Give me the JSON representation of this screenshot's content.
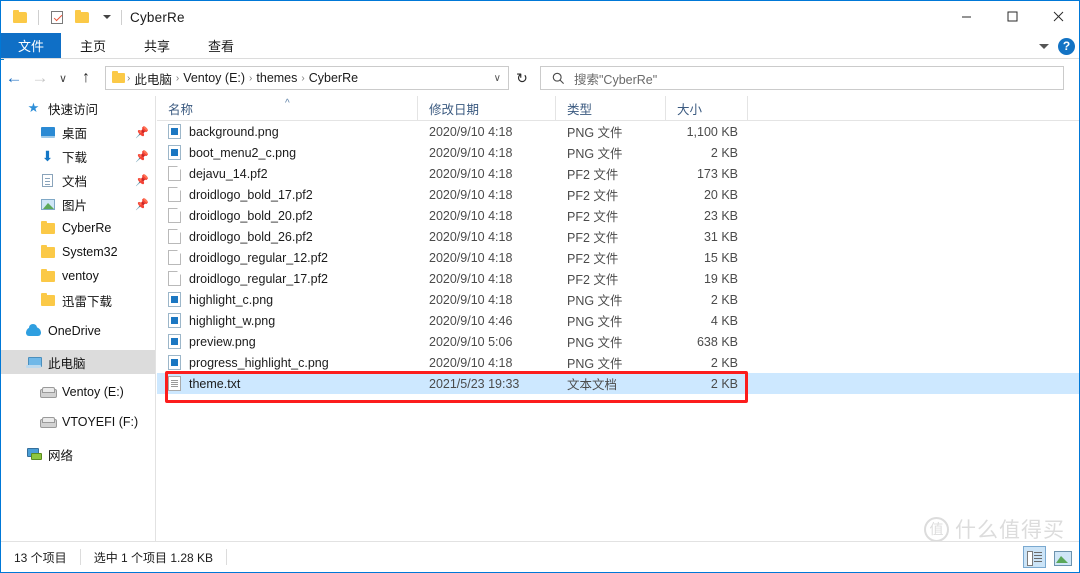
{
  "window": {
    "title": "CyberRe",
    "quick_access": [
      {
        "name": "folder-icon",
        "label": "CyberRe"
      },
      {
        "name": "properties-icon",
        "label": "属性"
      },
      {
        "name": "new-folder-icon",
        "label": "新建文件夹"
      },
      {
        "name": "customize-caret-icon",
        "label": "自定义快速访问工具栏"
      }
    ],
    "controls": {
      "minimize": "最小化",
      "maximize": "最大化",
      "close": "关闭"
    }
  },
  "ribbon": {
    "tabs": [
      {
        "label": "文件",
        "active": true
      },
      {
        "label": "主页",
        "active": false
      },
      {
        "label": "共享",
        "active": false
      },
      {
        "label": "查看",
        "active": false
      }
    ],
    "expand_label": "展开功能区",
    "help_label": "?"
  },
  "nav": {
    "back_label": "←",
    "forward_label": "→",
    "recent_label": "∨",
    "up_label": "↑",
    "breadcrumb": [
      "此电脑",
      "Ventoy (E:)",
      "themes",
      "CyberRe"
    ],
    "breadcrumb_separator": "›",
    "address_caret": "∨",
    "refresh_label": "↻"
  },
  "search": {
    "placeholder": "搜索\"CyberRe\"",
    "icon": "search-icon"
  },
  "sidebar": {
    "items": [
      {
        "label": "快速访问",
        "icon": "star-icon",
        "level": 0,
        "pinned": false,
        "selected": false
      },
      {
        "label": "桌面",
        "icon": "desktop-icon",
        "level": 1,
        "pinned": true,
        "selected": false
      },
      {
        "label": "下载",
        "icon": "download-icon",
        "level": 1,
        "pinned": true,
        "selected": false
      },
      {
        "label": "文档",
        "icon": "document-icon",
        "level": 1,
        "pinned": true,
        "selected": false
      },
      {
        "label": "图片",
        "icon": "pictures-icon",
        "level": 1,
        "pinned": true,
        "selected": false
      },
      {
        "label": "CyberRe",
        "icon": "folder-icon",
        "level": 1,
        "pinned": false,
        "selected": false
      },
      {
        "label": "System32",
        "icon": "folder-icon",
        "level": 1,
        "pinned": false,
        "selected": false
      },
      {
        "label": "ventoy",
        "icon": "folder-icon",
        "level": 1,
        "pinned": false,
        "selected": false
      },
      {
        "label": "迅雷下载",
        "icon": "folder-icon",
        "level": 1,
        "pinned": false,
        "selected": false
      },
      {
        "label": "OneDrive",
        "icon": "cloud-icon",
        "level": 0,
        "pinned": false,
        "selected": false
      },
      {
        "label": "此电脑",
        "icon": "this-pc-icon",
        "level": 0,
        "pinned": false,
        "selected": true
      },
      {
        "label": "Ventoy (E:)",
        "icon": "drive-icon",
        "level": 1,
        "pinned": false,
        "selected": false
      },
      {
        "label": "VTOYEFI (F:)",
        "icon": "drive-icon",
        "level": 1,
        "pinned": false,
        "selected": false
      },
      {
        "label": "网络",
        "icon": "network-icon",
        "level": 0,
        "pinned": false,
        "selected": false
      }
    ]
  },
  "filelist": {
    "columns": [
      {
        "label": "名称",
        "sorted": "asc"
      },
      {
        "label": "修改日期",
        "sorted": ""
      },
      {
        "label": "类型",
        "sorted": ""
      },
      {
        "label": "大小",
        "sorted": ""
      }
    ],
    "sort_caret": "^",
    "rows": [
      {
        "name": "background.png",
        "date": "2020/9/10 4:18",
        "type": "PNG 文件",
        "size": "1,100 KB",
        "icon": "png-file-icon",
        "selected": false
      },
      {
        "name": "boot_menu2_c.png",
        "date": "2020/9/10 4:18",
        "type": "PNG 文件",
        "size": "2 KB",
        "icon": "png-file-icon",
        "selected": false
      },
      {
        "name": "dejavu_14.pf2",
        "date": "2020/9/10 4:18",
        "type": "PF2 文件",
        "size": "173 KB",
        "icon": "generic-file-icon",
        "selected": false
      },
      {
        "name": "droidlogo_bold_17.pf2",
        "date": "2020/9/10 4:18",
        "type": "PF2 文件",
        "size": "20 KB",
        "icon": "generic-file-icon",
        "selected": false
      },
      {
        "name": "droidlogo_bold_20.pf2",
        "date": "2020/9/10 4:18",
        "type": "PF2 文件",
        "size": "23 KB",
        "icon": "generic-file-icon",
        "selected": false
      },
      {
        "name": "droidlogo_bold_26.pf2",
        "date": "2020/9/10 4:18",
        "type": "PF2 文件",
        "size": "31 KB",
        "icon": "generic-file-icon",
        "selected": false
      },
      {
        "name": "droidlogo_regular_12.pf2",
        "date": "2020/9/10 4:18",
        "type": "PF2 文件",
        "size": "15 KB",
        "icon": "generic-file-icon",
        "selected": false
      },
      {
        "name": "droidlogo_regular_17.pf2",
        "date": "2020/9/10 4:18",
        "type": "PF2 文件",
        "size": "19 KB",
        "icon": "generic-file-icon",
        "selected": false
      },
      {
        "name": "highlight_c.png",
        "date": "2020/9/10 4:18",
        "type": "PNG 文件",
        "size": "2 KB",
        "icon": "png-file-icon",
        "selected": false
      },
      {
        "name": "highlight_w.png",
        "date": "2020/9/10 4:46",
        "type": "PNG 文件",
        "size": "4 KB",
        "icon": "png-file-icon",
        "selected": false
      },
      {
        "name": "preview.png",
        "date": "2020/9/10 5:06",
        "type": "PNG 文件",
        "size": "638 KB",
        "icon": "png-file-icon",
        "selected": false
      },
      {
        "name": "progress_highlight_c.png",
        "date": "2020/9/10 4:18",
        "type": "PNG 文件",
        "size": "2 KB",
        "icon": "png-file-icon",
        "selected": false
      },
      {
        "name": "theme.txt",
        "date": "2021/5/23 19:33",
        "type": "文本文档",
        "size": "2 KB",
        "icon": "text-file-icon",
        "selected": true
      }
    ]
  },
  "annotation": {
    "color": "#fc1d1d",
    "target": "theme.txt"
  },
  "statusbar": {
    "item_count": "13 个项目",
    "selection": "选中 1 个项目  1.28 KB",
    "views": [
      {
        "name": "details-view-button",
        "active": true
      },
      {
        "name": "large-icons-view-button",
        "active": false
      }
    ]
  },
  "watermark": {
    "badge": "值",
    "text": "什么值得买"
  },
  "colors": {
    "accent": "#0078d7",
    "selection": "#cde8ff",
    "file_tab": "#0f6fc6",
    "annotation": "#fc1d1d"
  }
}
